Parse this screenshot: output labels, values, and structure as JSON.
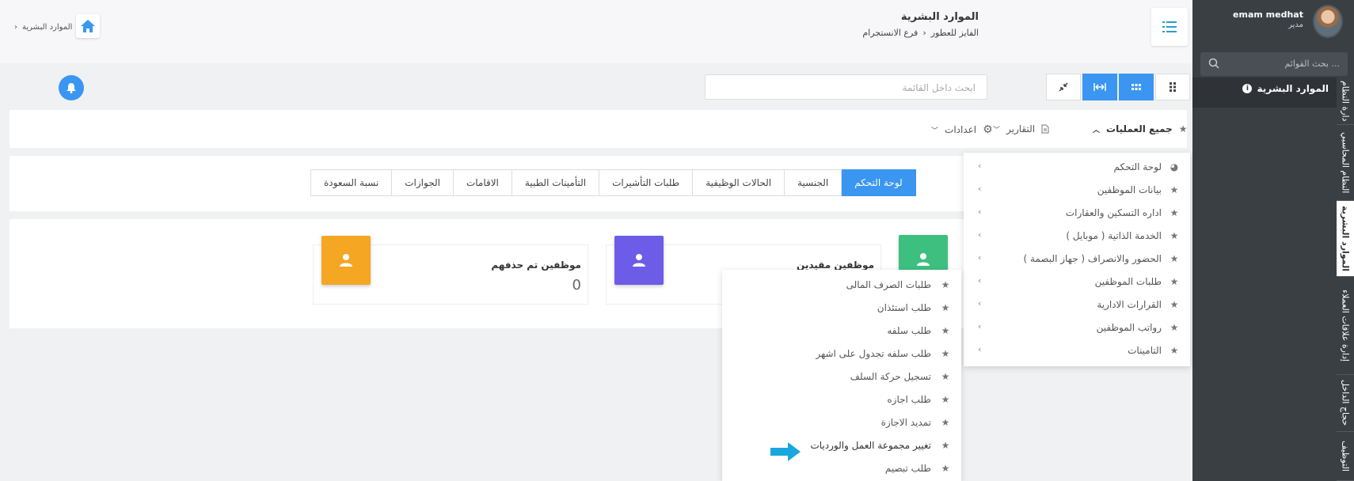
{
  "header": {
    "title": "الموارد البشرية",
    "breadcrumb": [
      "الفايز للعطور",
      "فرع الانستجرام"
    ],
    "left_crumb": "الموارد البشرية"
  },
  "user": {
    "name": "emam medhat",
    "role": "مدير"
  },
  "sidebar": {
    "search_placeholder": "بحث القوائم ...",
    "active_item": "الموارد البشرية",
    "vtabs": [
      "دارة النظام",
      "النظام المحاسبي",
      "الموارد البشرية",
      "إدارة علاقات العملاء",
      "حجاج الداخل",
      "التوظيف"
    ]
  },
  "toolbar": {
    "search_placeholder": "ابحث داخل القائمة"
  },
  "ops": {
    "all_ops": "جميع العمليات",
    "reports": "التقارير",
    "settings": "اعدادات"
  },
  "tabs": [
    "لوحة التحكم",
    "الجنسية",
    "الحالات الوظيفية",
    "طلبات التأشيرات",
    "التأمينات الطبية",
    "الاقامات",
    "الجوازات",
    "نسبة السعودة"
  ],
  "stats": [
    {
      "label": "موظفين تم حذفهم",
      "value": "0",
      "color": "#f5a623"
    },
    {
      "label": "موظفين مقيدين",
      "value": "",
      "color": "#6c5ce7"
    },
    {
      "label": "",
      "value": "",
      "color": "#3dbf80"
    }
  ],
  "menu1": [
    {
      "label": "لوحة التحكم",
      "icon": "dashboard-icon"
    },
    {
      "label": "بيانات الموظفين",
      "icon": "star-icon"
    },
    {
      "label": "اداره التسكين والعقارات",
      "icon": "star-icon"
    },
    {
      "label": "الخدمة الذاتية ( موبايل )",
      "icon": "star-icon"
    },
    {
      "label": "الحضور والانصراف ( جهاز البصمة )",
      "icon": "star-icon"
    },
    {
      "label": "طلبات الموظفين",
      "icon": "star-icon"
    },
    {
      "label": "القرارات الادارية",
      "icon": "star-icon"
    },
    {
      "label": "رواتب الموظفين",
      "icon": "star-icon"
    },
    {
      "label": "التامينات",
      "icon": "star-icon"
    }
  ],
  "menu2": [
    "طلبات الصرف المالى",
    "طلب استئذان",
    "طلب سلفه",
    "طلب سلفه تجدول على اشهر",
    "تسجيل حركة السلف",
    "طلب اجازه",
    "تمديد الاجازة",
    "تغيير مجموعة العمل والورديات",
    "طلب تبصيم"
  ],
  "colors": {
    "accent": "#3b96f1",
    "sidebar": "#3a3f44"
  }
}
